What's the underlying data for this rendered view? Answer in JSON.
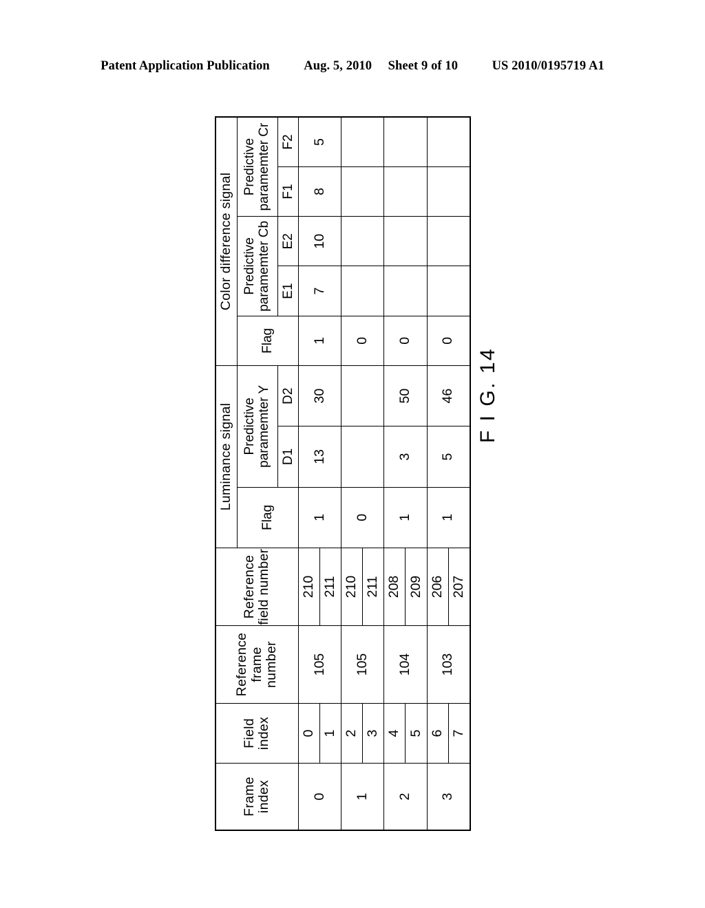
{
  "page_header": {
    "publication": "Patent Application Publication",
    "date": "Aug. 5, 2010",
    "sheet": "Sheet 9 of 10",
    "patent_number": "US 2010/0195719 A1"
  },
  "figure": {
    "label": "F I G. 14"
  },
  "table": {
    "columns": {
      "frame_index": "Frame index",
      "field_index": "Field index",
      "reference_frame_number_line1": "Reference",
      "reference_frame_number_line2": "frame number",
      "reference_field_number_line1": "Reference",
      "reference_field_number_line2": "field number",
      "luminance_signal": "Luminance signal",
      "color_difference_signal": "Color difference signal",
      "flag": "Flag",
      "predictive_parameter_y_line1": "Predictive",
      "predictive_parameter_y_line2": "paramemter Y",
      "predictive_parameter_cb_line1": "Predictive",
      "predictive_parameter_cb_line2": "paramemter Cb",
      "predictive_parameter_cr_line1": "Predictive",
      "predictive_parameter_cr_line2": "paramemter Cr",
      "d1": "D1",
      "d2": "D2",
      "e1": "E1",
      "e2": "E2",
      "f1": "F1",
      "f2": "F2"
    },
    "rows": [
      {
        "frame_index": "0",
        "field_index_a": "0",
        "field_index_b": "1",
        "reference_frame_number": "105",
        "reference_field_number_a": "210",
        "reference_field_number_b": "211",
        "luma_flag": "1",
        "d1": "13",
        "d2": "30",
        "chroma_flag": "1",
        "e1": "7",
        "e2": "10",
        "f1": "8",
        "f2": "5"
      },
      {
        "frame_index": "1",
        "field_index_a": "2",
        "field_index_b": "3",
        "reference_frame_number": "105",
        "reference_field_number_a": "210",
        "reference_field_number_b": "211",
        "luma_flag": "0",
        "d1": "",
        "d2": "",
        "chroma_flag": "0",
        "e1": "",
        "e2": "",
        "f1": "",
        "f2": ""
      },
      {
        "frame_index": "2",
        "field_index_a": "4",
        "field_index_b": "5",
        "reference_frame_number": "104",
        "reference_field_number_a": "208",
        "reference_field_number_b": "209",
        "luma_flag": "1",
        "d1": "3",
        "d2": "50",
        "chroma_flag": "0",
        "e1": "",
        "e2": "",
        "f1": "",
        "f2": ""
      },
      {
        "frame_index": "3",
        "field_index_a": "6",
        "field_index_b": "7",
        "reference_frame_number": "103",
        "reference_field_number_a": "206",
        "reference_field_number_b": "207",
        "luma_flag": "1",
        "d1": "5",
        "d2": "46",
        "chroma_flag": "0",
        "e1": "",
        "e2": "",
        "f1": "",
        "f2": ""
      }
    ]
  }
}
